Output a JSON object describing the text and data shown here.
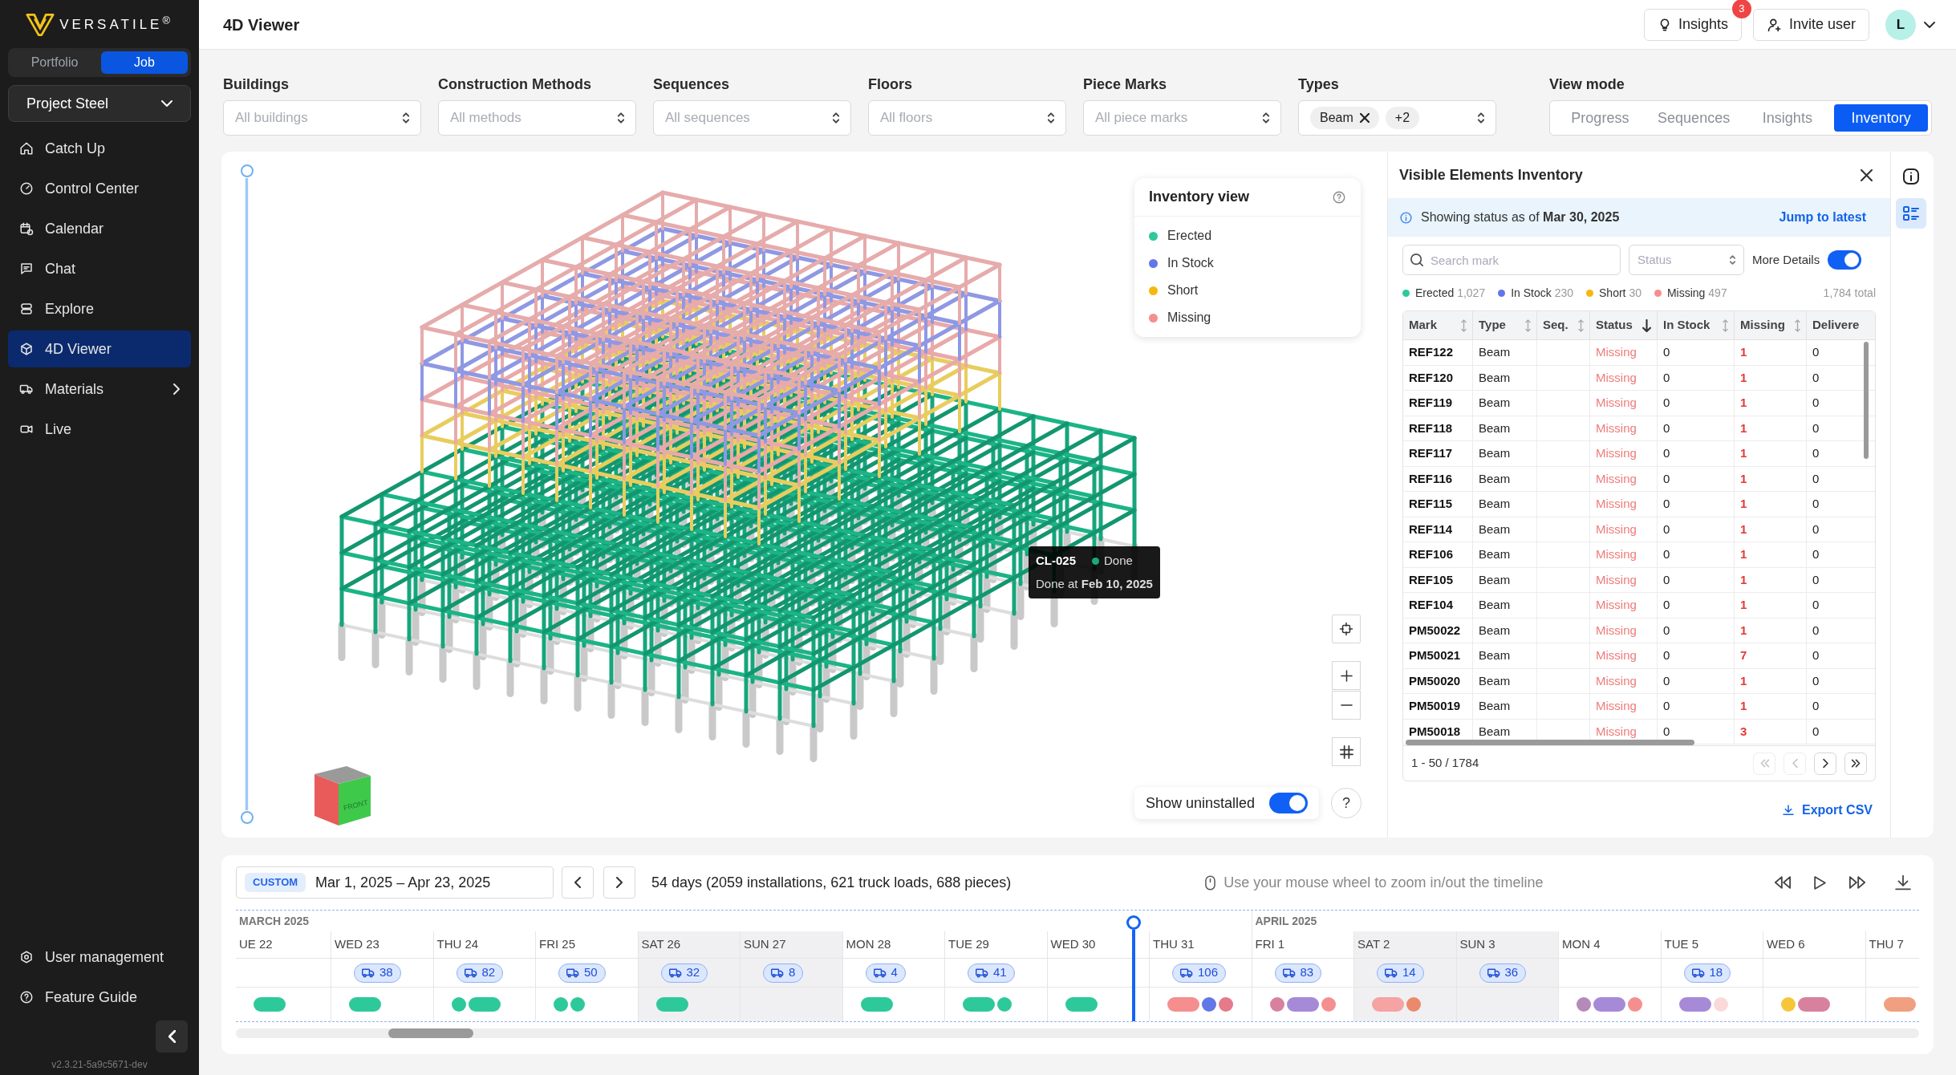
{
  "sidebar": {
    "logo": "VERSATILE$^{®}$",
    "scopes": [
      {
        "label": "Portfolio",
        "selected": false
      },
      {
        "label": "Job",
        "selected": true
      }
    ],
    "project": "Project Steel",
    "nav": [
      {
        "label": "Catch Up",
        "selected": false,
        "has_submenu": false
      },
      {
        "label": "Control Center",
        "selected": false,
        "has_submenu": false
      },
      {
        "label": "Calendar",
        "selected": false,
        "has_submenu": false
      },
      {
        "label": "Chat",
        "selected": false,
        "has_submenu": false
      },
      {
        "label": "Explore",
        "selected": false,
        "has_submenu": false
      },
      {
        "label": "4D Viewer",
        "selected": true,
        "has_submenu": false
      },
      {
        "label": "Materials",
        "selected": false,
        "has_submenu": true
      },
      {
        "label": "Live",
        "selected": false,
        "has_submenu": false
      }
    ],
    "bottom_nav": [
      {
        "label": "User management"
      },
      {
        "label": "Feature Guide"
      }
    ],
    "version": "v2.3.21-5a9c5671-dev"
  },
  "header": {
    "title": "4D Viewer",
    "insights_button": "Insights",
    "insights_badge": "3",
    "invite_button": "Invite user",
    "avatar": "L"
  },
  "filters": [
    {
      "label": "Buildings",
      "placeholder": "All buildings"
    },
    {
      "label": "Construction Methods",
      "placeholder": "All methods"
    },
    {
      "label": "Sequences",
      "placeholder": "All sequences"
    },
    {
      "label": "Floors",
      "placeholder": "All floors"
    },
    {
      "label": "Piece Marks",
      "placeholder": "All piece marks"
    },
    {
      "label": "Types",
      "chips": [
        {
          "label": "Beam",
          "removable": true
        },
        {
          "label": "+2",
          "removable": false
        }
      ]
    }
  ],
  "view_mode": {
    "label": "View mode",
    "options": [
      {
        "label": "Progress",
        "selected": false
      },
      {
        "label": "Sequences",
        "selected": false
      },
      {
        "label": "Insights",
        "selected": false
      },
      {
        "label": "Inventory",
        "selected": true
      }
    ]
  },
  "viewer": {
    "level_slider": {
      "level": 1
    },
    "legend": {
      "title": "Inventory view",
      "items": [
        {
          "label": "Erected",
          "color": "#2ec99a"
        },
        {
          "label": "In Stock",
          "color": "#6276e8"
        },
        {
          "label": "Short",
          "color": "#f5b80b"
        },
        {
          "label": "Missing",
          "color": "#f58f8f"
        }
      ]
    },
    "tooltip": {
      "mark": "CL-025",
      "status": "Done",
      "detail": "Done at **Feb 10, 2025**"
    },
    "view_cube": {
      "face_label": "FRONT"
    },
    "show_uninstalled": {
      "label": "Show uninstalled",
      "on": true
    },
    "help": "?"
  },
  "inventory": {
    "title": "Visible Elements Inventory",
    "banner": "Showing status as of **Mar 30, 2025**",
    "jump_link": "Jump to latest",
    "search": {
      "placeholder": "Search mark"
    },
    "status_filter": {
      "placeholder": "Status"
    },
    "more_details": {
      "label": "More Details",
      "on": true
    },
    "stats": [
      {
        "label": "Erected",
        "count": "1,027",
        "color": "#2ec99a"
      },
      {
        "label": "In Stock",
        "count": "230",
        "color": "#6276e8"
      },
      {
        "label": "Short",
        "count": "30",
        "color": "#f5b80b"
      },
      {
        "label": "Missing",
        "count": "497",
        "color": "#f58f8f"
      }
    ],
    "total": "1,784 total",
    "table": {
      "columns": [
        {
          "label": "Mark",
          "sortable": true,
          "sorted": false
        },
        {
          "label": "Type",
          "sortable": true,
          "sorted": false
        },
        {
          "label": "Seq.",
          "sortable": true,
          "sorted": false
        },
        {
          "label": "Status",
          "sortable": true,
          "sorted": true
        },
        {
          "label": "In Stock",
          "sortable": true,
          "sorted": false
        },
        {
          "label": "Missing",
          "sortable": true,
          "sorted": false
        },
        {
          "label": "Delivere"
        }
      ],
      "rows": [
        {
          "mark": "REF122",
          "type": "Beam",
          "status": "Missing",
          "in_stock": "0",
          "missing": "1",
          "delivered": "0"
        },
        {
          "mark": "REF120",
          "type": "Beam",
          "status": "Missing",
          "in_stock": "0",
          "missing": "1",
          "delivered": "0"
        },
        {
          "mark": "REF119",
          "type": "Beam",
          "status": "Missing",
          "in_stock": "0",
          "missing": "1",
          "delivered": "0"
        },
        {
          "mark": "REF118",
          "type": "Beam",
          "status": "Missing",
          "in_stock": "0",
          "missing": "1",
          "delivered": "0"
        },
        {
          "mark": "REF117",
          "type": "Beam",
          "status": "Missing",
          "in_stock": "0",
          "missing": "1",
          "delivered": "0"
        },
        {
          "mark": "REF116",
          "type": "Beam",
          "status": "Missing",
          "in_stock": "0",
          "missing": "1",
          "delivered": "0"
        },
        {
          "mark": "REF115",
          "type": "Beam",
          "status": "Missing",
          "in_stock": "0",
          "missing": "1",
          "delivered": "0"
        },
        {
          "mark": "REF114",
          "type": "Beam",
          "status": "Missing",
          "in_stock": "0",
          "missing": "1",
          "delivered": "0"
        },
        {
          "mark": "REF106",
          "type": "Beam",
          "status": "Missing",
          "in_stock": "0",
          "missing": "1",
          "delivered": "0"
        },
        {
          "mark": "REF105",
          "type": "Beam",
          "status": "Missing",
          "in_stock": "0",
          "missing": "1",
          "delivered": "0"
        },
        {
          "mark": "REF104",
          "type": "Beam",
          "status": "Missing",
          "in_stock": "0",
          "missing": "1",
          "delivered": "0"
        },
        {
          "mark": "PM50022",
          "type": "Beam",
          "status": "Missing",
          "in_stock": "0",
          "missing": "1",
          "delivered": "0"
        },
        {
          "mark": "PM50021",
          "type": "Beam",
          "status": "Missing",
          "in_stock": "0",
          "missing": "7",
          "delivered": "0"
        },
        {
          "mark": "PM50020",
          "type": "Beam",
          "status": "Missing",
          "in_stock": "0",
          "missing": "1",
          "delivered": "0"
        },
        {
          "mark": "PM50019",
          "type": "Beam",
          "status": "Missing",
          "in_stock": "0",
          "missing": "1",
          "delivered": "0"
        },
        {
          "mark": "PM50018",
          "type": "Beam",
          "status": "Missing",
          "in_stock": "0",
          "missing": "3",
          "delivered": "0"
        }
      ]
    },
    "pagination": {
      "range": "1 - 50 / 1784",
      "buttons": [
        {
          "kind": "first",
          "disabled": true
        },
        {
          "kind": "prev",
          "disabled": true
        },
        {
          "kind": "next",
          "disabled": false
        },
        {
          "kind": "last",
          "disabled": false
        }
      ]
    },
    "export_link": "Export CSV"
  },
  "panel_tabs": [
    {
      "kind": "info",
      "selected": false
    },
    {
      "kind": "list",
      "selected": true
    }
  ],
  "timeline": {
    "range_badge": "CUSTOM",
    "range": "Mar 1, 2025 – Apr 23, 2025",
    "summary": "54 days (2059 installations, 621 truck loads, 688 pieces)",
    "hint": "Use your mouse wheel to zoom in/out the timeline",
    "days": [
      {
        "label": "UE 22",
        "month": "MARCH 2025",
        "weekend": false,
        "current": false,
        "markers": [
          {
            "kind": "pill",
            "color": "#2ec99a"
          }
        ]
      },
      {
        "label": "WED 23",
        "weekend": false,
        "current": false,
        "trucks": "38",
        "markers": [
          {
            "kind": "pill",
            "color": "#2ec99a"
          }
        ]
      },
      {
        "label": "THU 24",
        "weekend": false,
        "current": false,
        "trucks": "82",
        "markers": [
          {
            "kind": "dot",
            "color": "#2ec99a"
          },
          {
            "kind": "pill",
            "color": "#2ec99a"
          }
        ]
      },
      {
        "label": "FRI 25",
        "weekend": false,
        "current": false,
        "trucks": "50",
        "markers": [
          {
            "kind": "dot",
            "color": "#2ec99a"
          },
          {
            "kind": "dot",
            "color": "#2ec99a"
          }
        ]
      },
      {
        "label": "SAT 26",
        "weekend": true,
        "current": false,
        "trucks": "32",
        "markers": [
          {
            "kind": "pill",
            "color": "#2ec99a"
          }
        ]
      },
      {
        "label": "SUN 27",
        "weekend": true,
        "current": false,
        "trucks": "8"
      },
      {
        "label": "MON 28",
        "weekend": false,
        "current": false,
        "trucks": "4",
        "markers": [
          {
            "kind": "pill",
            "color": "#2ec99a"
          }
        ]
      },
      {
        "label": "TUE 29",
        "weekend": false,
        "current": false,
        "trucks": "41",
        "markers": [
          {
            "kind": "pill",
            "color": "#2ec99a"
          },
          {
            "kind": "dot",
            "color": "#2ec99a"
          }
        ]
      },
      {
        "label": "WED 30",
        "weekend": false,
        "current": true,
        "markers": [
          {
            "kind": "pill",
            "color": "#2ec99a"
          }
        ]
      },
      {
        "label": "THU 31",
        "weekend": false,
        "current": false,
        "trucks": "106",
        "markers": [
          {
            "kind": "pill",
            "color": "#f58f8f"
          },
          {
            "kind": "dot",
            "color": "#6276e8"
          },
          {
            "kind": "dot",
            "color": "#e57a8a"
          }
        ]
      },
      {
        "label": "FRI 1",
        "month": "APRIL 2025",
        "weekend": false,
        "current": false,
        "trucks": "83",
        "markers": [
          {
            "kind": "dot",
            "color": "#d7819e"
          },
          {
            "kind": "pill",
            "color": "#a68ad8"
          },
          {
            "kind": "dot",
            "color": "#f58f8f"
          }
        ]
      },
      {
        "label": "SAT 2",
        "weekend": true,
        "current": false,
        "trucks": "14",
        "markers": [
          {
            "kind": "pill",
            "color": "#f5a3a3"
          },
          {
            "kind": "dot",
            "color": "#ea8a6a"
          }
        ]
      },
      {
        "label": "SUN 3",
        "weekend": true,
        "current": false,
        "trucks": "36"
      },
      {
        "label": "MON 4",
        "weekend": false,
        "current": false,
        "markers": [
          {
            "kind": "dot",
            "color": "#b48ab8"
          },
          {
            "kind": "pill",
            "color": "#a68ad8"
          },
          {
            "kind": "dot",
            "color": "#f58f8f"
          }
        ]
      },
      {
        "label": "TUE 5",
        "weekend": false,
        "current": false,
        "trucks": "18",
        "markers": [
          {
            "kind": "pill",
            "color": "#a68ad8"
          },
          {
            "kind": "dot",
            "color": "#fbd9d9"
          }
        ]
      },
      {
        "label": "WED 6",
        "weekend": false,
        "current": false,
        "markers": [
          {
            "kind": "dot",
            "color": "#f5c63a"
          },
          {
            "kind": "pill",
            "color": "#d7819e"
          }
        ]
      },
      {
        "label": "THU 7",
        "weekend": false,
        "current": false,
        "markers": [
          {
            "kind": "pill",
            "color": "#f0a080"
          }
        ]
      }
    ]
  }
}
